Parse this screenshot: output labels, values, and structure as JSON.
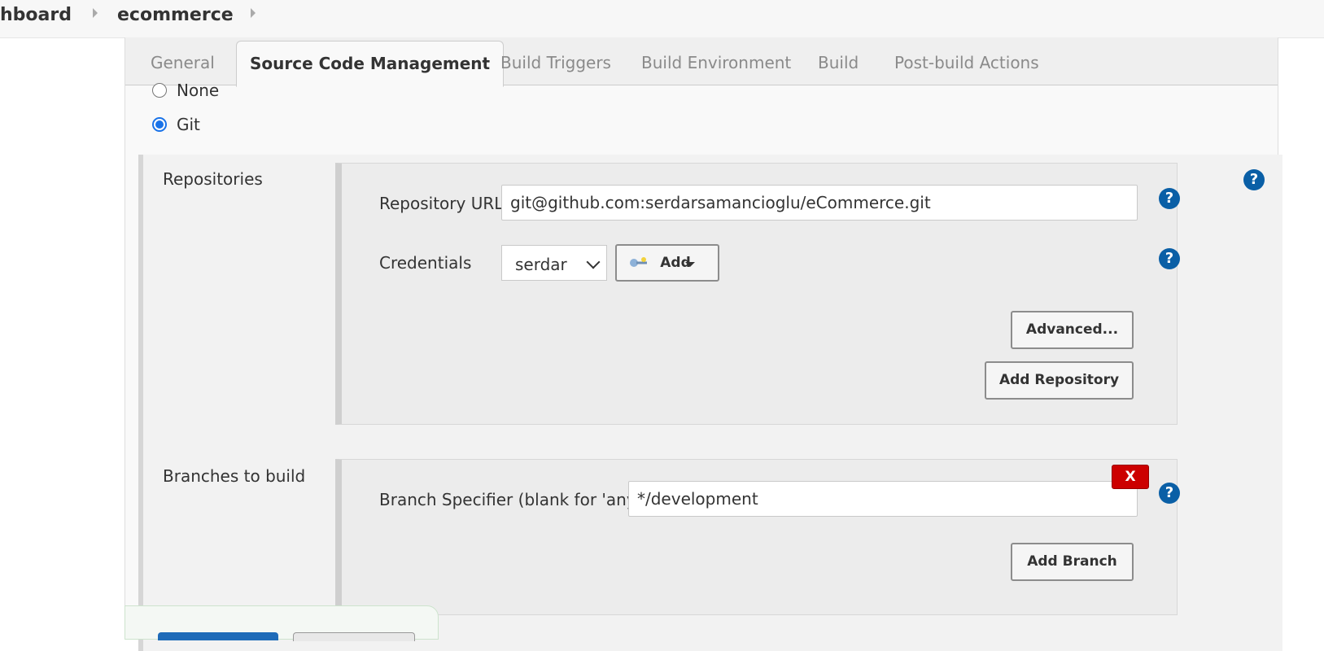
{
  "breadcrumb": {
    "items": [
      "hboard",
      "ecommerce"
    ]
  },
  "tabs": [
    {
      "label": "General",
      "active": false
    },
    {
      "label": "Source Code Management",
      "active": true
    },
    {
      "label": "Build Triggers",
      "active": false
    },
    {
      "label": "Build Environment",
      "active": false
    },
    {
      "label": "Build",
      "active": false
    },
    {
      "label": "Post-build Actions",
      "active": false
    }
  ],
  "scm": {
    "options": [
      {
        "label": "None",
        "selected": false
      },
      {
        "label": "Git",
        "selected": true
      }
    ],
    "repositories": {
      "section_label": "Repositories",
      "url_label": "Repository URL",
      "url_value": "git@github.com:serdarsamancioglu/eCommerce.git",
      "credentials_label": "Credentials",
      "credentials_value": "serdar",
      "add_label": "Add",
      "advanced_label": "Advanced...",
      "add_repository_label": "Add Repository"
    },
    "branches": {
      "section_label": "Branches to build",
      "specifier_label": "Branch Specifier (blank for 'any')",
      "specifier_value": "*/development",
      "delete_label": "X",
      "add_branch_label": "Add Branch"
    },
    "help_glyph": "?"
  },
  "colors": {
    "help": "#0a5fa6",
    "delete": "#cc0000",
    "radio_checked": "#1a73e8",
    "save_button": "#1e6bb8"
  },
  "icons": {
    "help": "help-icon",
    "key": "key-icon",
    "caret": "caret-down-icon",
    "breadcrumb_separator": "chevron-right-icon",
    "select_chevron": "chevron-down-icon"
  }
}
